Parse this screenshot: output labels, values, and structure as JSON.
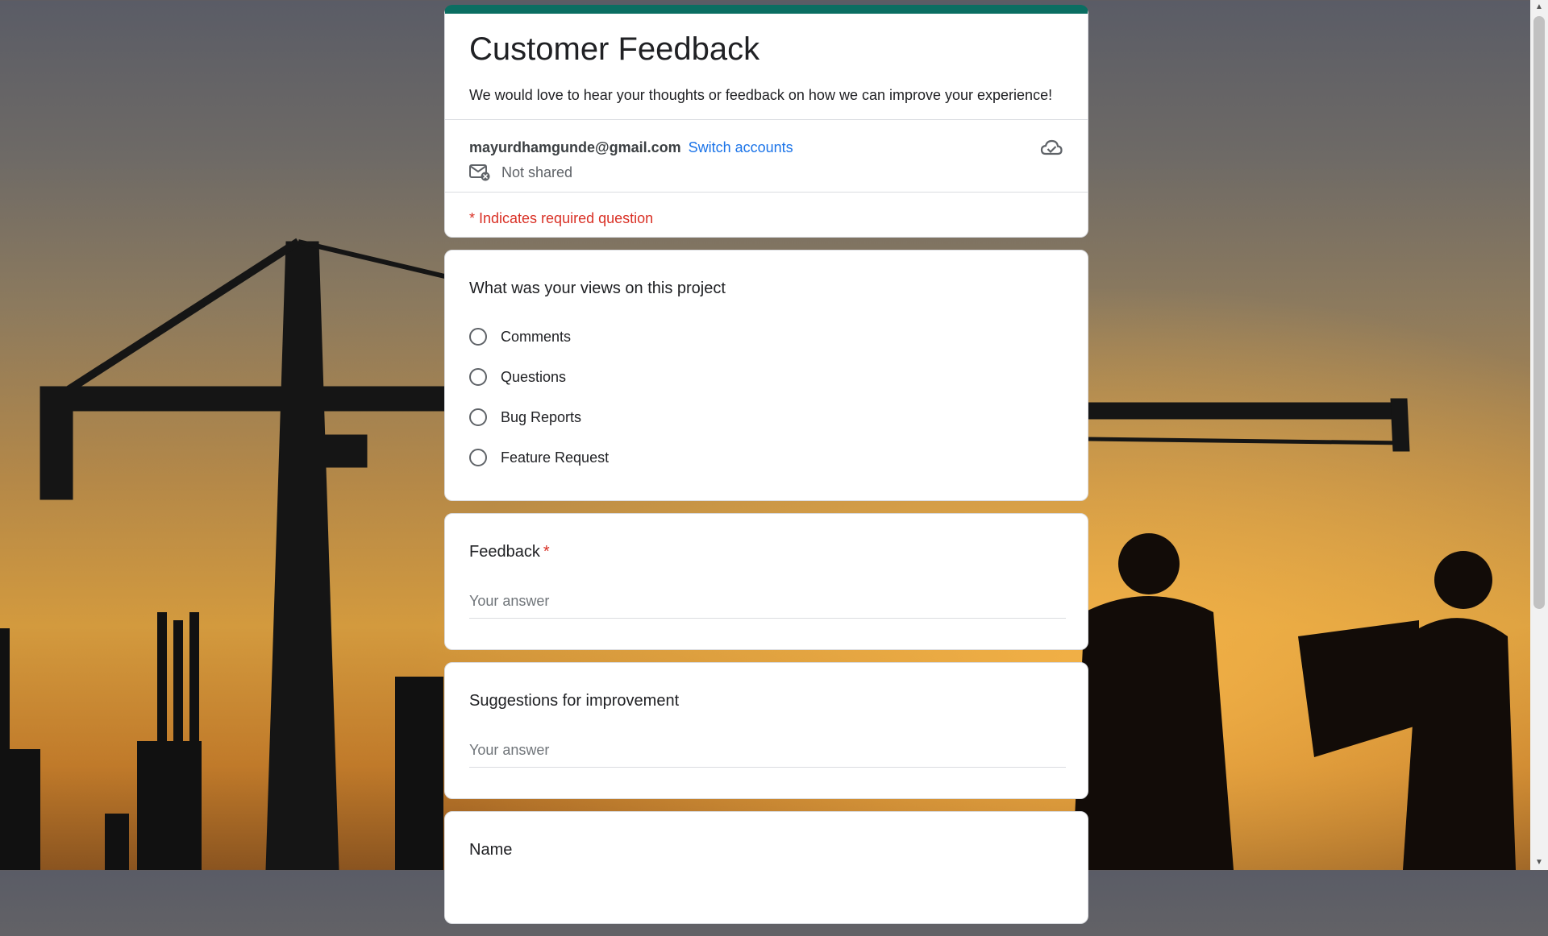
{
  "form": {
    "title": "Customer Feedback",
    "description": "We would love to hear your thoughts or feedback on how we can improve your experience!",
    "account_email": "mayurdhamgunde@gmail.com",
    "switch_accounts": "Switch accounts",
    "sharing_status": "Not shared",
    "required_note": "* Indicates required question",
    "accent_color": "#0b6e62"
  },
  "questions": [
    {
      "title": "What was your views on this project",
      "type": "radio",
      "options": [
        "Comments",
        "Questions",
        "Bug Reports",
        "Feature Request"
      ]
    },
    {
      "title": "Feedback",
      "required_mark": "*",
      "type": "short_answer",
      "placeholder": "Your answer"
    },
    {
      "title": "Suggestions for improvement",
      "type": "short_answer",
      "placeholder": "Your answer"
    },
    {
      "title": "Name",
      "type": "short_answer"
    }
  ],
  "icons": {
    "cloud": "cloud-save-icon",
    "mail": "mail-not-shared-icon"
  }
}
